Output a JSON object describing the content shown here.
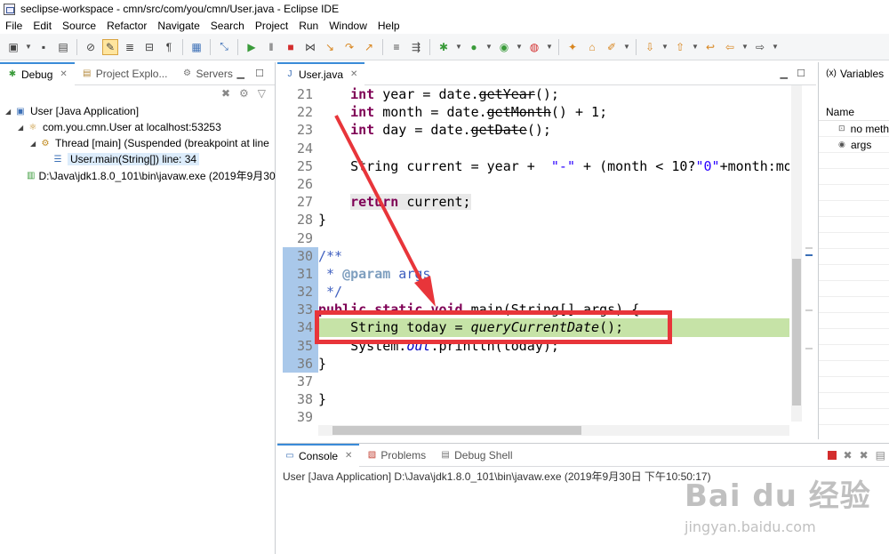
{
  "window": {
    "title": "seclipse-workspace - cmn/src/com/you/cmn/User.java - Eclipse IDE"
  },
  "menu": [
    "File",
    "Edit",
    "Source",
    "Refactor",
    "Navigate",
    "Search",
    "Project",
    "Run",
    "Window",
    "Help"
  ],
  "debug_view": {
    "tabs": [
      {
        "label": "Debug",
        "icon": "debug-icon"
      },
      {
        "label": "Project Explo...",
        "icon": "project-explorer-icon"
      },
      {
        "label": "Servers",
        "icon": "servers-icon"
      }
    ],
    "tree": [
      {
        "label": "User [Java Application]",
        "icon": "java-app-icon"
      },
      {
        "label": "com.you.cmn.User at localhost:53253",
        "icon": "vm-icon"
      },
      {
        "label": "Thread [main] (Suspended (breakpoint at line",
        "icon": "thread-icon"
      },
      {
        "label": "User.main(String[]) line: 34",
        "icon": "stack-frame-icon"
      },
      {
        "label": "D:\\Java\\jdk1.8.0_101\\bin\\javaw.exe (2019年9月30",
        "icon": "process-icon"
      }
    ]
  },
  "editor": {
    "tab_label": "User.java",
    "line_numbers": [
      "21",
      "22",
      "23",
      "24",
      "25",
      "26",
      "27",
      "28",
      "29",
      "30",
      "31",
      "32",
      "33",
      "34",
      "35",
      "36",
      "37",
      "38",
      "39"
    ],
    "current_line": "34"
  },
  "variables_view": {
    "tab_label": "Variables",
    "column_header": "Name",
    "rows": [
      {
        "name": "no meth",
        "icon": "no-method-icon"
      },
      {
        "name": "args",
        "icon": "local-variable-icon"
      }
    ]
  },
  "console_view": {
    "tabs": [
      {
        "label": "Console",
        "icon": "console-icon"
      },
      {
        "label": "Problems",
        "icon": "problems-icon"
      },
      {
        "label": "Debug Shell",
        "icon": "debug-shell-icon"
      }
    ],
    "output": "User [Java Application] D:\\Java\\jdk1.8.0_101\\bin\\javaw.exe (2019年9月30日 下午10:50:17)"
  },
  "watermark": {
    "logo": "Bai du 经验",
    "url": "jingyan.baidu.com"
  },
  "colors": {
    "keyword": "#7f0055",
    "field": "#0000c0",
    "string": "#2a00ff",
    "javadoc": "#3f5fbf",
    "debug_highlight": "#c6e3a7",
    "annotation_box": "#e8353a",
    "active_tab_accent": "#3a8bd8"
  }
}
